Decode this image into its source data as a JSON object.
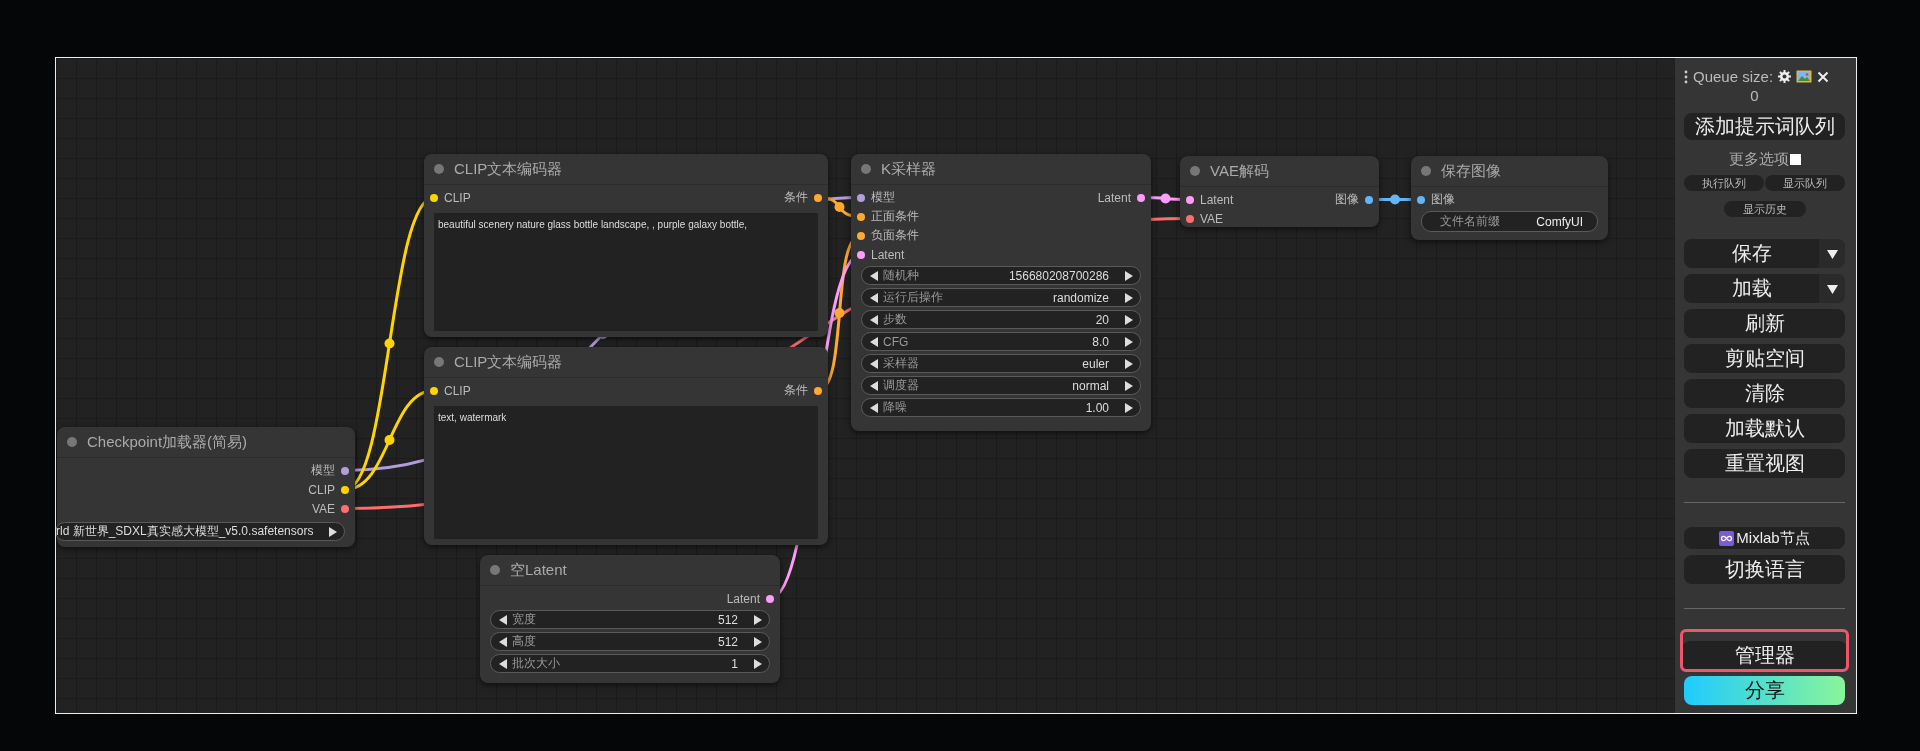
{
  "canvas": {
    "nodes": [
      {
        "title": "CLIP文本编码器",
        "inputs": [
          {
            "label": "CLIP",
            "color": "#ffd500"
          }
        ],
        "outputs": [
          {
            "label": "条件",
            "color": "#ffa931"
          }
        ],
        "widgets": [
          {
            "kind": "prompt",
            "value": "beautiful scenery nature glass bottle landscape, , purple galaxy bottle,"
          }
        ]
      },
      {
        "title": "CLIP文本编码器",
        "inputs": [
          {
            "label": "CLIP",
            "color": "#ffd500"
          }
        ],
        "outputs": [
          {
            "label": "条件",
            "color": "#ffa931"
          }
        ],
        "widgets": [
          {
            "kind": "prompt",
            "value": "text, watermark"
          }
        ]
      },
      {
        "title": "Checkpoint加载器(简易)",
        "outputs": [
          {
            "label": "模型",
            "color": "#b39ddb"
          },
          {
            "label": "CLIP",
            "color": "#ffd500"
          },
          {
            "label": "VAE",
            "color": "#ff6e6e"
          }
        ],
        "widgets": [
          {
            "kind": "file",
            "value": "rld 新世界_SDXL真实感大模型_v5.0.safetensors"
          }
        ]
      },
      {
        "title": "空Latent",
        "outputs": [
          {
            "label": "Latent",
            "color": "#ff9cf9"
          }
        ],
        "widgets": [
          {
            "kind": "spinner",
            "label": "宽度",
            "value": "512"
          },
          {
            "kind": "spinner",
            "label": "高度",
            "value": "512"
          },
          {
            "kind": "spinner",
            "label": "批次大小",
            "value": "1"
          }
        ]
      },
      {
        "title": "K采样器",
        "inputs": [
          {
            "label": "模型",
            "color": "#b39ddb"
          },
          {
            "label": "正面条件",
            "color": "#ffa931"
          },
          {
            "label": "负面条件",
            "color": "#ffa931"
          },
          {
            "label": "Latent",
            "color": "#ff9cf9"
          }
        ],
        "outputs": [
          {
            "label": "Latent",
            "color": "#ff9cf9"
          }
        ],
        "widgets": [
          {
            "kind": "spinner",
            "label": "随机种",
            "value": "156680208700286"
          },
          {
            "kind": "spinner",
            "label": "运行后操作",
            "value": "randomize"
          },
          {
            "kind": "spinner",
            "label": "步数",
            "value": "20"
          },
          {
            "kind": "spinner",
            "label": "CFG",
            "value": "8.0"
          },
          {
            "kind": "spinner",
            "label": "采样器",
            "value": "euler"
          },
          {
            "kind": "spinner",
            "label": "调度器",
            "value": "normal"
          },
          {
            "kind": "spinner",
            "label": "降噪",
            "value": "1.00"
          }
        ]
      },
      {
        "title": "VAE解码",
        "inputs": [
          {
            "label": "Latent",
            "color": "#ff9cf9"
          },
          {
            "label": "VAE",
            "color": "#ff6e6e"
          }
        ],
        "outputs": [
          {
            "label": "图像",
            "color": "#64b5f6"
          }
        ]
      },
      {
        "title": "保存图像",
        "inputs": [
          {
            "label": "图像",
            "color": "#64b5f6"
          }
        ],
        "widgets": [
          {
            "kind": "text",
            "label": "文件名前缀",
            "value": "ComfyUI"
          }
        ]
      }
    ]
  },
  "side_panel": {
    "queue_label": "Queue size:",
    "queue_size": "0",
    "add_prompt_button": "添加提示词队列",
    "more_options": {
      "label": "更多选项",
      "checked": false
    },
    "queue_buttons": [
      "执行队列",
      "显示队列"
    ],
    "history_button": "显示历史",
    "sections": [
      {
        "buttons": [
          {
            "label": "保存",
            "kind": "dropdown",
            "highlighted": false
          },
          {
            "label": "加载",
            "kind": "dropdown",
            "highlighted": false
          },
          {
            "label": "刷新",
            "kind": "menu",
            "highlighted": false
          },
          {
            "label": "剪贴空间",
            "kind": "menu",
            "highlighted": false
          },
          {
            "label": "清除",
            "kind": "menu",
            "highlighted": false
          },
          {
            "label": "加载默认",
            "kind": "menu",
            "highlighted": false
          },
          {
            "label": "重置视图",
            "kind": "menu",
            "highlighted": false
          }
        ]
      },
      {
        "buttons": [
          {
            "label": "Mixlab节点",
            "kind": "mixlab",
            "highlighted": false
          },
          {
            "label": "切换语言",
            "kind": "menu",
            "highlighted": false
          }
        ]
      },
      {
        "buttons": [
          {
            "label": "管理器",
            "kind": "menu",
            "highlighted": true
          },
          {
            "label": "分享",
            "kind": "share",
            "highlighted": false
          }
        ]
      }
    ]
  }
}
